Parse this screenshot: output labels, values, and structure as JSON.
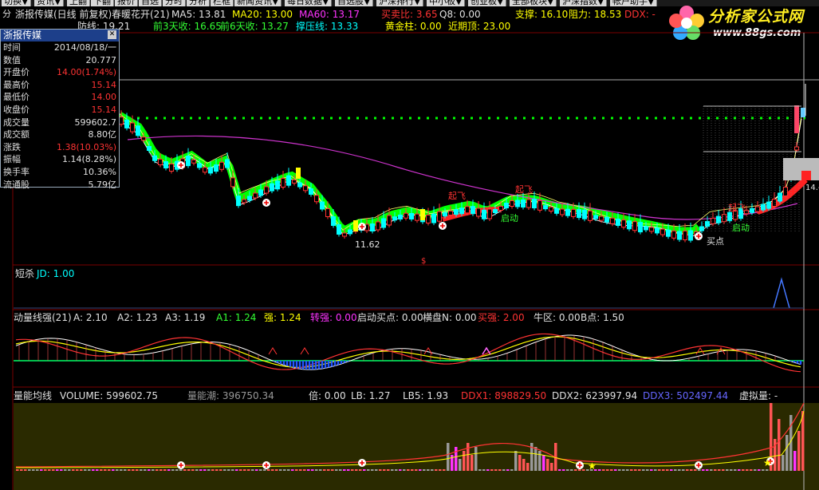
{
  "menu": [
    "切换▼",
    "资讯▼",
    "上翻",
    "下翻",
    "报价",
    "自选",
    "分时",
    "分析",
    "栏框",
    "新闻资讯▼",
    "每日数据▼",
    "自选股▼",
    "沪深排行▼",
    "中小板▼",
    "创业板▼",
    "全部板块▼",
    "沪深指数▼",
    "帐户助手▼"
  ],
  "header": {
    "side_label": "分",
    "title": "浙报传媒(日线 前复权)",
    "indicator": "春暖花开(21)",
    "ma5": "MA5: 13.81",
    "ma20": "MA20: 13.00",
    "ma60": "MA60: 13.17",
    "maichu": "买卖比: 3.65",
    "q8": "Q8: 0.00",
    "zhicheng": "支撑: 16.10",
    "zuli": "阻力: 18.53",
    "ddx": "DDX: -",
    "line2_a": "防线: 19.21",
    "line2_b": "前3天收: 16.65",
    "line2_c": "前6天收: 13.27",
    "line2_d": "撑压线: 13.33",
    "line2_e": "黄金柱: 0.00",
    "line2_f": "近期顶: 23.00"
  },
  "logo": {
    "name": "分析家公式网",
    "url": "www.88gs.com"
  },
  "info_window": {
    "title": "浙报传媒",
    "rows": [
      {
        "label": "时间",
        "value": "2014/08/18/一",
        "color": "#e0e0e0"
      },
      {
        "label": "数值",
        "value": "20.777",
        "color": "#e0e0e0"
      },
      {
        "label": "开盘价",
        "value": "14.00(1.74%)",
        "color": "#ff3333"
      },
      {
        "label": "最高价",
        "value": "15.14",
        "color": "#ff3333"
      },
      {
        "label": "最低价",
        "value": "14.00",
        "color": "#ff3333"
      },
      {
        "label": "收盘价",
        "value": "15.14",
        "color": "#ff3333"
      },
      {
        "label": "成交量",
        "value": "599602.7",
        "color": "#e0e0e0"
      },
      {
        "label": "成交额",
        "value": "8.80亿",
        "color": "#e0e0e0"
      },
      {
        "label": "涨跌",
        "value": "1.38(10.03%)",
        "color": "#ff3333"
      },
      {
        "label": "振幅",
        "value": "1.14(8.28%)",
        "color": "#e0e0e0"
      },
      {
        "label": "换手率",
        "value": "10.36%",
        "color": "#e0e0e0"
      },
      {
        "label": "流通股",
        "value": "5.79亿",
        "color": "#e0e0e0"
      }
    ]
  },
  "price_chart": {
    "annotations": {
      "low_price": "11.62",
      "buy": "买点",
      "qifei": "起飞",
      "qidong": "启动",
      "side_price": "14.-"
    }
  },
  "panel_short": {
    "title": "短杀",
    "jd": "JD: 1.00"
  },
  "panel_momentum": {
    "title": "动量线强(21)",
    "a": "A: 2.10",
    "a2": "A2: 1.23",
    "a3": "A3: 1.19",
    "a1": "A1: 1.24",
    "qiang": "强: 1.24",
    "zhuanqiang": "转强: 0.00",
    "qidongmaidian": "启动买点: 0.00",
    "hengpan": "横盘N: 0.00",
    "maiqiang": "买强: 2.00",
    "niuqu": "牛区: 0.00",
    "bdian": "B点: 1.50"
  },
  "panel_volume": {
    "title": "量能均线",
    "volume": "VOLUME: 599602.75",
    "liangnengchao": "量能潮: 396750.34",
    "bei": "倍: 0.00",
    "lb": "LB: 1.27",
    "lb5": "LB5: 1.93",
    "ddx1": "DDX1: 898829.50",
    "ddx2": "DDX2: 623997.94",
    "ddx3": "DDX3: 502497.44",
    "xuniliang": "虚拟量: -"
  },
  "colors": {
    "up": "#ff3333",
    "down": "#00ffff",
    "ma_green": "#00ff00",
    "ma_magenta": "#cc33cc",
    "ma_white": "#ffffff",
    "ma_yellow": "#ffff00",
    "grid": "#a0a0a0"
  }
}
